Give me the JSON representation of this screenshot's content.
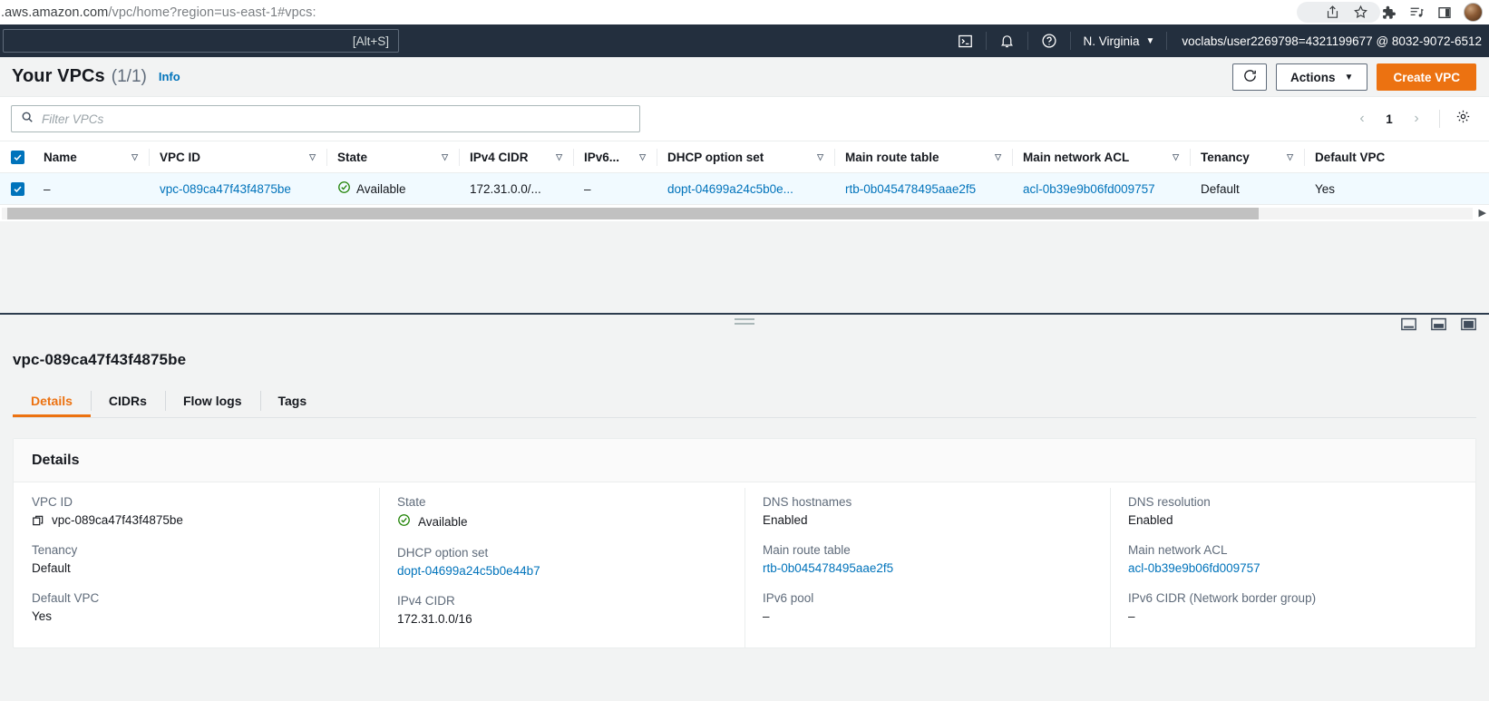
{
  "browser": {
    "url_prefix": ".aws.amazon.com",
    "url_path": "/vpc/home?region=us-east-1#vpcs:",
    "icons": [
      "share-icon",
      "bookmark-star-icon",
      "extensions-puzzle-icon",
      "reading-list-icon",
      "split-screen-icon",
      "profile-avatar"
    ]
  },
  "awsnav": {
    "search_shortcut": "[Alt+S]",
    "cloudshell_icon": "cloudshell-icon",
    "bell_icon": "notifications-bell-icon",
    "help_icon": "help-question-icon",
    "region": "N. Virginia",
    "region_caret": "▼",
    "account": "voclabs/user2269798=4321199677 @ 8032-9072-6512"
  },
  "header": {
    "title": "Your VPCs",
    "count": "(1/1)",
    "info": "Info",
    "refresh_label": "refresh-icon",
    "actions_label": "Actions",
    "actions_caret": "▼",
    "create_label": "Create VPC",
    "accent_color": "#ec7211"
  },
  "filter": {
    "placeholder": "Filter VPCs",
    "value": "",
    "search_icon": "search-icon"
  },
  "pagination": {
    "prev": "‹",
    "page": "1",
    "next": "›",
    "settings_icon": "gear-icon"
  },
  "table": {
    "columns": [
      {
        "label": "Name",
        "sort": "▽"
      },
      {
        "label": "VPC ID",
        "sort": "▽"
      },
      {
        "label": "State",
        "sort": "▽"
      },
      {
        "label": "IPv4 CIDR",
        "sort": "▽"
      },
      {
        "label": "IPv6...",
        "sort": "▽"
      },
      {
        "label": "DHCP option set",
        "sort": "▽"
      },
      {
        "label": "Main route table",
        "sort": "▽"
      },
      {
        "label": "Main network ACL",
        "sort": "▽"
      },
      {
        "label": "Tenancy",
        "sort": "▽"
      },
      {
        "label": "Default VPC",
        "sort": ""
      }
    ],
    "rows": [
      {
        "selected": true,
        "name": "–",
        "vpc_id": "vpc-089ca47f43f4875be",
        "state": "Available",
        "ipv4_cidr": "172.31.0.0/...",
        "ipv6": "–",
        "dhcp_option_set": "dopt-04699a24c5b0e...",
        "main_route_table": "rtb-0b045478495aae2f5",
        "main_network_acl": "acl-0b39e9b06fd009757",
        "tenancy": "Default",
        "default_vpc": "Yes"
      }
    ],
    "link_color": "#0073bb",
    "status_color": "#1d8102",
    "selected_row_color": "#f1faff"
  },
  "splitter": {
    "drag_handle": "drag-handle",
    "layout_icons": [
      "panel-bottom-icon",
      "panel-side-icon",
      "panel-full-icon"
    ]
  },
  "detail": {
    "title": "vpc-089ca47f43f4875be",
    "tabs": [
      {
        "label": "Details",
        "active": true
      },
      {
        "label": "CIDRs",
        "active": false
      },
      {
        "label": "Flow logs",
        "active": false
      },
      {
        "label": "Tags",
        "active": false
      }
    ],
    "card_title": "Details",
    "columns": [
      [
        {
          "label": "VPC ID",
          "value": "vpc-089ca47f43f4875be",
          "kind": "copy"
        },
        {
          "label": "Tenancy",
          "value": "Default",
          "kind": "text"
        },
        {
          "label": "Default VPC",
          "value": "Yes",
          "kind": "text"
        }
      ],
      [
        {
          "label": "State",
          "value": "Available",
          "kind": "status"
        },
        {
          "label": "DHCP option set",
          "value": "dopt-04699a24c5b0e44b7",
          "kind": "link"
        },
        {
          "label": "IPv4 CIDR",
          "value": "172.31.0.0/16",
          "kind": "text"
        }
      ],
      [
        {
          "label": "DNS hostnames",
          "value": "Enabled",
          "kind": "text"
        },
        {
          "label": "Main route table",
          "value": "rtb-0b045478495aae2f5",
          "kind": "link"
        },
        {
          "label": "IPv6 pool",
          "value": "–",
          "kind": "text"
        }
      ],
      [
        {
          "label": "DNS resolution",
          "value": "Enabled",
          "kind": "text"
        },
        {
          "label": "Main network ACL",
          "value": "acl-0b39e9b06fd009757",
          "kind": "link"
        },
        {
          "label": "IPv6 CIDR (Network border group)",
          "value": "–",
          "kind": "text"
        }
      ]
    ]
  }
}
